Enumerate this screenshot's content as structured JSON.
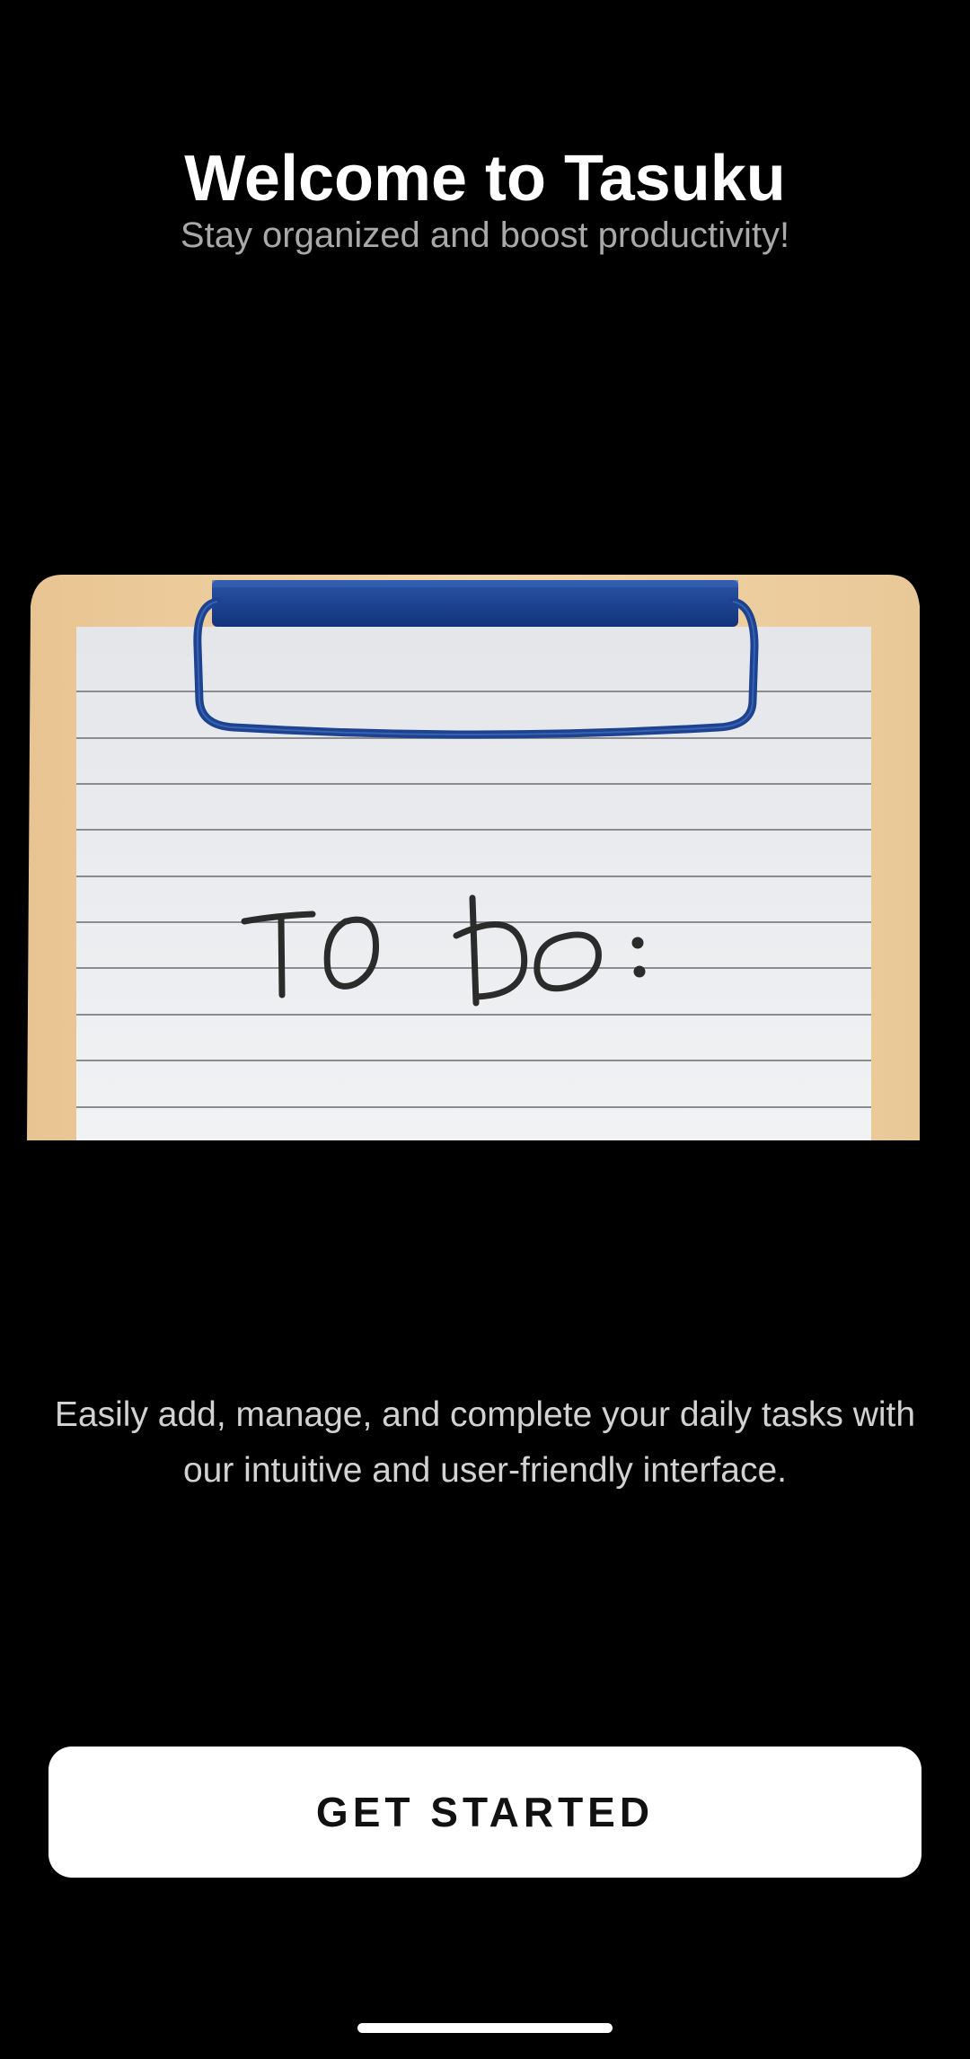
{
  "welcome": {
    "title": "Welcome to Tasuku",
    "subtitle": "Stay organized and boost productivity!"
  },
  "hero_image": {
    "handwritten_text": "TO DO:",
    "colors": {
      "clipboard": "#f2d3a6",
      "paper": "#ecedf0",
      "clip": "#173f8a"
    }
  },
  "description": "Easily add, manage, and complete your daily tasks with our intuitive and user-friendly interface.",
  "cta": {
    "label": "GET STARTED"
  },
  "colors": {
    "background": "#000000",
    "title": "#ffffff",
    "subtitle": "#a9a9a9",
    "button_bg": "#ffffff",
    "button_text": "#111111"
  }
}
